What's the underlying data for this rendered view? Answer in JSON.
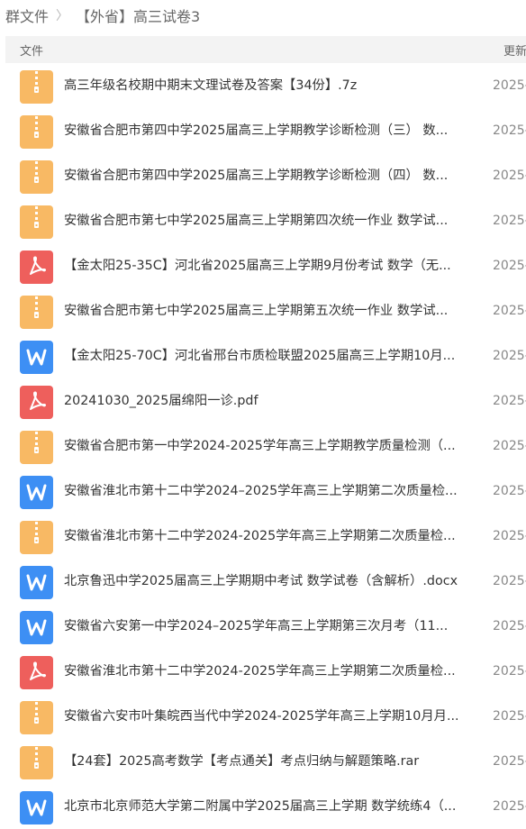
{
  "breadcrumb": {
    "root": "群文件",
    "separator": "〉",
    "current": "【外省】高三试卷3"
  },
  "table_header": {
    "file_col": "文件",
    "updated_col": "更新"
  },
  "colors": {
    "zip": "#f8b964",
    "pdf": "#ee5f5c",
    "word": "#3d8ff4",
    "header_bg": "#f3f3f3"
  },
  "files": [
    {
      "icon": "zip-file-icon",
      "name": "高三年级名校期中期末文理试卷及答案【34份】.7z",
      "date": "2025-"
    },
    {
      "icon": "zip-file-icon",
      "name": "安徽省合肥市第四中学2025届高三上学期教学诊断检测（三） 数...",
      "date": "2025-"
    },
    {
      "icon": "zip-file-icon",
      "name": "安徽省合肥市第四中学2025届高三上学期教学诊断检测（四） 数...",
      "date": "2025-"
    },
    {
      "icon": "zip-file-icon",
      "name": "安徽省合肥市第七中学2025届高三上学期第四次统一作业 数学试...",
      "date": "2025-"
    },
    {
      "icon": "pdf-file-icon",
      "name": "【金太阳25-35C】河北省2025届高三上学期9月份考试 数学（无...",
      "date": "2025-"
    },
    {
      "icon": "zip-file-icon",
      "name": "安徽省合肥市第七中学2025届高三上学期第五次统一作业 数学试...",
      "date": "2025-"
    },
    {
      "icon": "word-file-icon",
      "name": "【金太阳25-70C】河北省邢台市质检联盟2025届高三上学期10月...",
      "date": "2025-"
    },
    {
      "icon": "pdf-file-icon",
      "name": "20241030_2025届绵阳一诊.pdf",
      "date": "2025-"
    },
    {
      "icon": "zip-file-icon",
      "name": "安徽省合肥市第一中学2024-2025学年高三上学期教学质量检测（...",
      "date": "2025-"
    },
    {
      "icon": "word-file-icon",
      "name": "安徽省淮北市第十二中学2024–2025学年高三上学期第二次质量检...",
      "date": "2025-"
    },
    {
      "icon": "zip-file-icon",
      "name": "安徽省淮北市第十二中学2024-2025学年高三上学期第二次质量检...",
      "date": "2025-"
    },
    {
      "icon": "word-file-icon",
      "name": "北京鲁迅中学2025届高三上学期期中考试 数学试卷（含解析）.docx",
      "date": "2025-"
    },
    {
      "icon": "word-file-icon",
      "name": "安徽省六安第一中学2024–2025学年高三上学期第三次月考（11...",
      "date": "2025-"
    },
    {
      "icon": "pdf-file-icon",
      "name": "安徽省淮北市第十二中学2024-2025学年高三上学期第二次质量检...",
      "date": "2025-"
    },
    {
      "icon": "zip-file-icon",
      "name": "安徽省六安市叶集皖西当代中学2024-2025学年高三上学期10月月...",
      "date": "2025-"
    },
    {
      "icon": "zip-file-icon",
      "name": "【24套】2025高考数学【考点通关】考点归纳与解题策略.rar",
      "date": "2025-"
    },
    {
      "icon": "word-file-icon",
      "name": "北京市北京师范大学第二附属中学2025届高三上学期 数学统练4（...",
      "date": "2025-"
    }
  ]
}
